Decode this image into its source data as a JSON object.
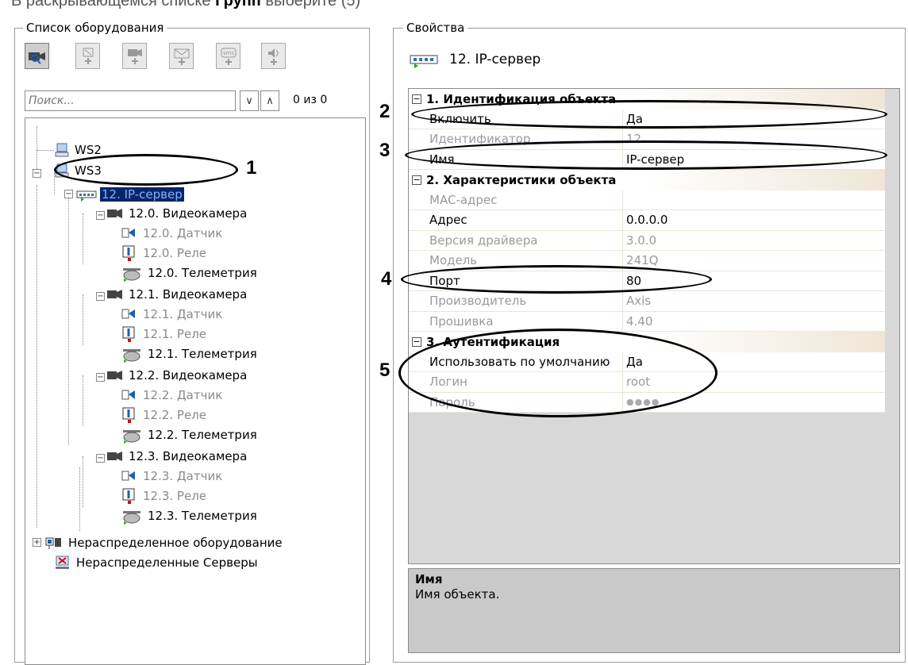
{
  "top_caption": {
    "before": "В раскрывающемся списке ",
    "bold": "Групп",
    "after": " выберите (5)"
  },
  "left_panel": {
    "title": "Список оборудования",
    "toolbar": [
      {
        "icon": "camera-search-icon",
        "active": true
      },
      {
        "icon": "add-sensor-icon",
        "active": false
      },
      {
        "icon": "add-camera-icon",
        "active": false
      },
      {
        "icon": "add-email-icon",
        "active": false
      },
      {
        "icon": "add-sms-icon",
        "active": false
      },
      {
        "icon": "add-sound-icon",
        "active": false
      }
    ],
    "search": {
      "placeholder": "Поиск...",
      "value": "",
      "prev_glyph": "∨",
      "next_glyph": "∧",
      "count": "0 из 0"
    },
    "tree": {
      "ws2": "WS2",
      "ws3": "WS3",
      "ip_server": "12. IP-сервер",
      "cam0": {
        "camera": "12.0. Видеокамера",
        "sensor": "12.0. Датчик",
        "relay": "12.0. Реле",
        "telemetry": "12.0. Телеметрия"
      },
      "cam1": {
        "camera": "12.1. Видеокамера",
        "sensor": "12.1. Датчик",
        "relay": "12.1. Реле",
        "telemetry": "12.1. Телеметрия"
      },
      "cam2": {
        "camera": "12.2. Видеокамера",
        "sensor": "12.2. Датчик",
        "relay": "12.2. Реле",
        "telemetry": "12.2. Телеметрия"
      },
      "cam3": {
        "camera": "12.3. Видеокамера",
        "sensor": "12.3. Датчик",
        "relay": "12.3. Реле",
        "telemetry": "12.3. Телеметрия"
      },
      "unassigned_equipment": "Нераспределенное оборудование",
      "unassigned_servers": "Нераспределенные Серверы"
    }
  },
  "right_panel": {
    "title": "Свойства",
    "object_title": "12. IP-сервер",
    "sections": {
      "s1": "1. Идентификация объекта",
      "s2": "2. Характеристики объекта",
      "s3": "3. Аутентификация"
    },
    "rows": {
      "enable": {
        "name": "Включить",
        "value": "Да"
      },
      "identifier": {
        "name": "Идентификатор",
        "value": "12"
      },
      "name": {
        "name": "Имя",
        "value": "IP-сервер"
      },
      "mac": {
        "name": "MAC-адрес",
        "value": ""
      },
      "address": {
        "name": "Адрес",
        "value": "0.0.0.0"
      },
      "driver": {
        "name": "Версия драйвера",
        "value": "3.0.0"
      },
      "model": {
        "name": "Модель",
        "value": "241Q"
      },
      "port": {
        "name": "Порт",
        "value": "80"
      },
      "vendor": {
        "name": "Производитель",
        "value": "Axis"
      },
      "firmware": {
        "name": "Прошивка",
        "value": "4.40"
      },
      "use_default": {
        "name": "Использовать по умолчанию",
        "value": "Да"
      },
      "login": {
        "name": "Логин",
        "value": "root"
      },
      "password": {
        "name": "Пароль",
        "value": "●●●●"
      }
    },
    "description": {
      "title": "Имя",
      "text": "Имя объекта."
    }
  },
  "callouts": {
    "c1": "1",
    "c2": "2",
    "c3": "3",
    "c4": "4",
    "c5": "5"
  }
}
